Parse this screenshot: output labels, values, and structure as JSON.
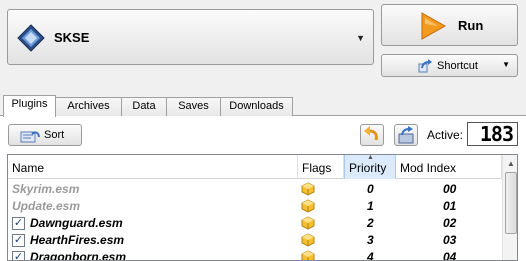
{
  "executable": {
    "selected": "SKSE",
    "icon": "skse-diamond-icon",
    "dropdown_arrow": "▼"
  },
  "run": {
    "label": "Run",
    "icon": "play-arrow-icon"
  },
  "shortcut": {
    "label": "Shortcut",
    "icon": "shortcut-arrow-icon",
    "arrow": "▼"
  },
  "tabs": [
    {
      "label": "Plugins",
      "active": true
    },
    {
      "label": "Archives"
    },
    {
      "label": "Data"
    },
    {
      "label": "Saves"
    },
    {
      "label": "Downloads"
    }
  ],
  "toolbar": {
    "sort_label": "Sort",
    "active_label": "Active:",
    "active_count": "183"
  },
  "table": {
    "columns": {
      "name": "Name",
      "flags": "Flags",
      "priority": "Priority",
      "mod_index": "Mod Index"
    },
    "sort_indicator": "▲",
    "rows": [
      {
        "name": "Skyrim.esm",
        "priority": "0",
        "mod_index": "00",
        "checkbox": false,
        "checked": false,
        "greyed": true
      },
      {
        "name": "Update.esm",
        "priority": "1",
        "mod_index": "01",
        "checkbox": false,
        "checked": false,
        "greyed": true
      },
      {
        "name": "Dawnguard.esm",
        "priority": "2",
        "mod_index": "02",
        "checkbox": true,
        "checked": true,
        "greyed": false
      },
      {
        "name": "HearthFires.esm",
        "priority": "3",
        "mod_index": "03",
        "checkbox": true,
        "checked": true,
        "greyed": false
      },
      {
        "name": "Dragonborn.esm",
        "priority": "4",
        "mod_index": "04",
        "checkbox": true,
        "checked": true,
        "greyed": false
      }
    ],
    "check_glyph": "✓"
  },
  "colors": {
    "run_orange": "#f29a1e",
    "accent_blue": "#3a72c4",
    "flag_yellow": "#f4c030"
  }
}
